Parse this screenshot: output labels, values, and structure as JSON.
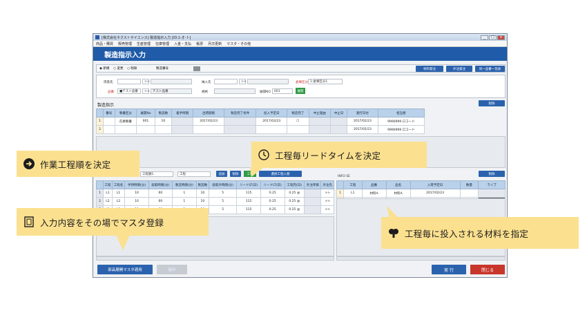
{
  "window": {
    "title": "[株式会社ネクストサイエンス] 製造指示入力 [ID:1-オ-ト]",
    "menu": [
      "商品・購買",
      "販売管理",
      "生産管理",
      "在庫管理",
      "入金・支払",
      "帳票",
      "月次更新",
      "マスタ・その他"
    ],
    "page_title": "製造指示入力"
  },
  "toolbar": {
    "modes": [
      "新規",
      "変更",
      "削除"
    ],
    "order_no_label": "製造番号",
    "buttons": [
      "材料発注",
      "外注発注",
      "同一品番一括表"
    ]
  },
  "header_form": {
    "customer_label": "得意先",
    "delivery_label": "納入先",
    "warehouse_label": "倉庫区分",
    "warehouse_value": "1:倉庫区分1",
    "item_label": "品番",
    "item_value": "■テスト品番",
    "item_name": "テスト品番",
    "spec_label": "規格",
    "route_label": "展開NO",
    "route_value": "001",
    "route_button": "展開",
    "btn_small": ">>"
  },
  "instructions": {
    "section_label": "製造指示",
    "delete_button": "削除",
    "columns": [
      "番号",
      "製番区分",
      "展開No",
      "製造数",
      "着手時期",
      "出荷期限",
      "製造完了条件",
      "投入予定日",
      "製造完了",
      "中止理由",
      "中止日",
      "発行日付",
      "担当者",
      "取引日付"
    ],
    "rows": [
      {
        "no": "1",
        "type": "在庫製番",
        "route": "001",
        "qty": "10",
        "ship": "2017/02/23",
        "plan": "2017/02/23",
        "issue": "2017/02/23",
        "staff_code": "9990999",
        "staff": "ロコード"
      },
      {
        "no": "2",
        "issue": "2017/02/23",
        "staff_code": "9990999",
        "staff": "ロコード"
      }
    ]
  },
  "process_grid": {
    "select_label": "工程順1",
    "select_value": "工程",
    "buttons": [
      "追加",
      "削除",
      "工程",
      "選択工程入替"
    ],
    "columns": [
      "工程",
      "工程名",
      "手持時間(分)",
      "段取時間(分)",
      "製造時間(分)",
      "製造数",
      "段取外時間(分)",
      "リードLT(日)",
      "リードLT(日)",
      "工程内(日)",
      "外注単価",
      "外注先"
    ],
    "rows": [
      {
        "no": "1",
        "proc": "L1",
        "name": "L1",
        "t1": "10",
        "t2": "60",
        "qty": "1",
        "t3": "10",
        "lt1": "5",
        "lt2": "115",
        "rate": "0.25",
        "cost": "0.25 @"
      },
      {
        "no": "2",
        "proc": "L2",
        "name": "L2",
        "t1": "10",
        "t2": "60",
        "qty": "1",
        "t3": "10",
        "lt1": "5",
        "lt2": "115",
        "rate": "0.25",
        "cost": "0.25 @"
      },
      {
        "no": "3",
        "proc": "L3",
        "name": "L3",
        "t1": "10",
        "t2": "60",
        "qty": "1",
        "t3": "10",
        "lt1": "5",
        "lt2": "115",
        "rate": "0.25",
        "cost": "0.25 @"
      }
    ]
  },
  "material_grid": {
    "info_label": "INFO SE",
    "delete_button": "削除",
    "columns": [
      "工程",
      "品番",
      "品名",
      "入荷予定日",
      "数量",
      "ライブ"
    ],
    "rows": [
      {
        "no": "1",
        "proc": "L1",
        "item": "材料A",
        "name": "材料A",
        "date": "2017/02/23"
      }
    ]
  },
  "footer": {
    "master_button": "部品展開マスタ適用",
    "disabled_button": "操作",
    "exec_button": "実 行",
    "close_button": "閉じる"
  },
  "callouts": [
    {
      "text": "作業工程順を決定",
      "icon": "arrow-right-circle-icon"
    },
    {
      "text": "工程毎リードタイムを決定",
      "icon": "clock-icon"
    },
    {
      "text": "入力内容をその場でマスタ登録",
      "icon": "form-icon"
    },
    {
      "text": "工程毎に投入される材料を指定",
      "icon": "lightbulb-icon"
    }
  ],
  "colors": {
    "title_bar": "#1f5ba8",
    "callout": "#fbe08f",
    "exec": "#2b62ad",
    "close": "#c8352b",
    "grid_header": "#b9d1ea"
  }
}
